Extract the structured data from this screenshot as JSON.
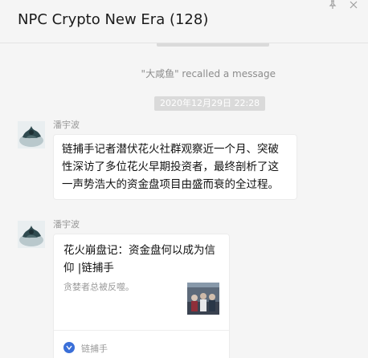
{
  "window": {
    "title": "NPC Crypto New Era (128)",
    "pin_icon": "pin-icon",
    "close_icon": "close-icon"
  },
  "chat": {
    "recall_notice": "\"大咸鱼\" recalled a message",
    "timestamp": "2020年12月29日 22:28",
    "messages": [
      {
        "sender": "潘宇波",
        "avatar_icon": "avatar-image",
        "text": "链捕手记者潜伏花火社群观察近一个月、突破性深访了多位花火早期投资者，最终剖析了这一声势浩大的资金盘项目由盛而衰的全过程。"
      },
      {
        "sender": "潘宇波",
        "avatar_icon": "avatar-image",
        "card": {
          "title": "花火崩盘记：资金盘何以成为信仰 |链捕手",
          "description": "贪婪者总被反噬。",
          "thumbnail_icon": "article-thumbnail",
          "source": "链捕手",
          "source_icon": "source-logo-icon"
        }
      }
    ]
  },
  "colors": {
    "background": "#f5f5f5",
    "bubble": "#ffffff",
    "time_chip": "#dadada",
    "muted_text": "#999999"
  }
}
